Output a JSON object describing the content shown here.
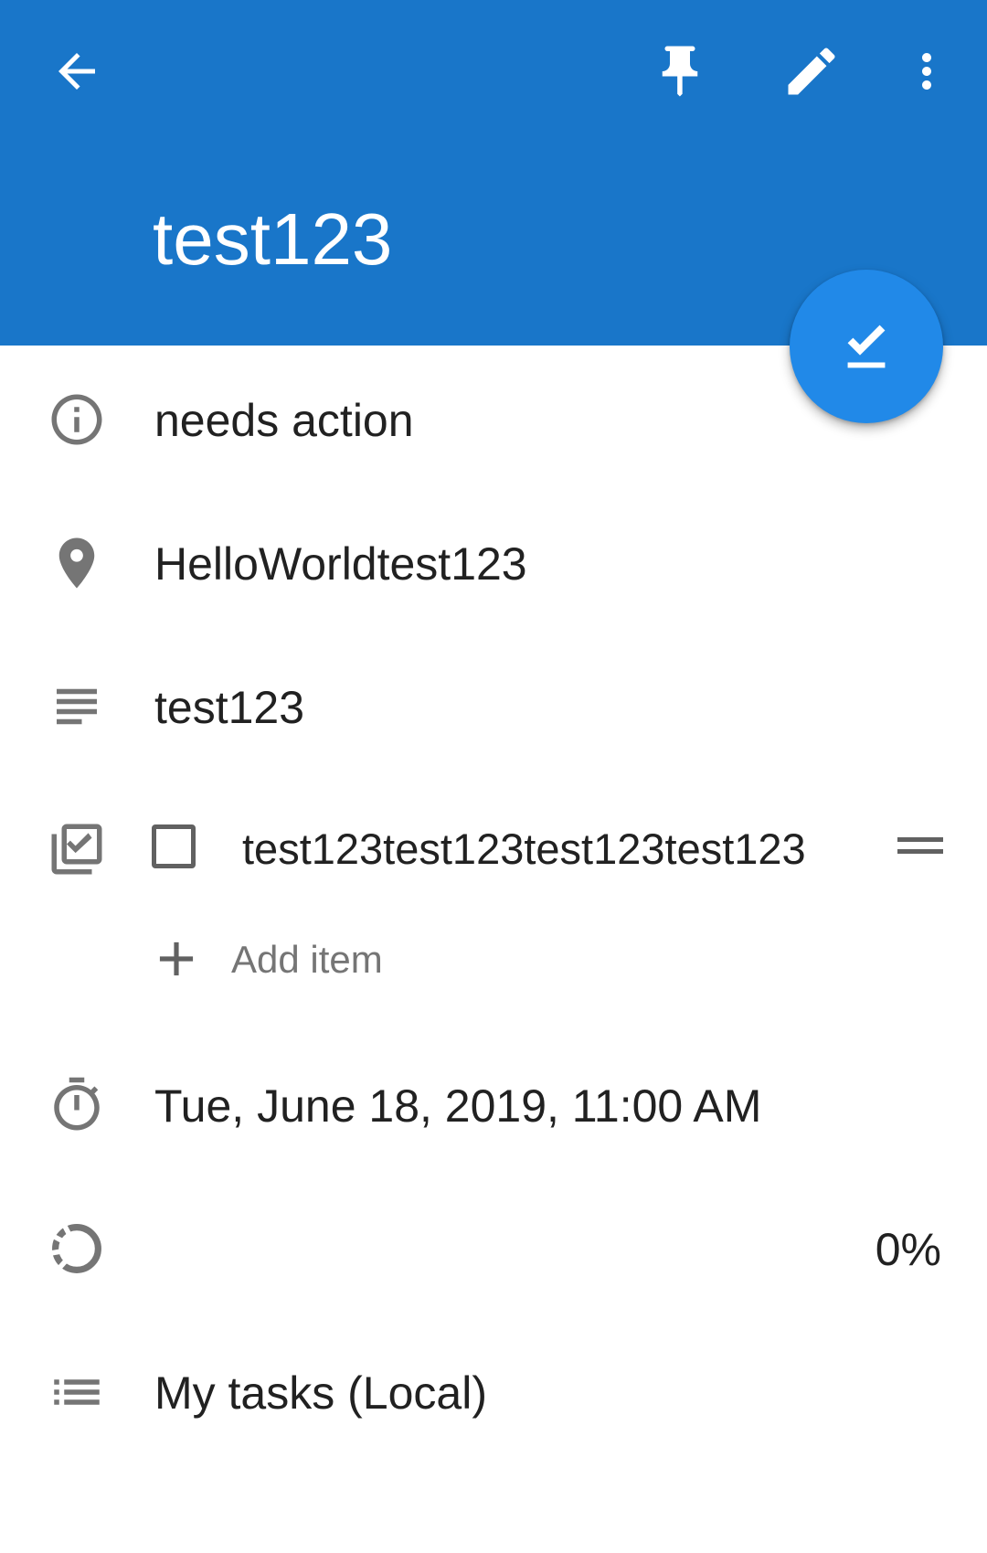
{
  "toolbar": {
    "back_icon": "arrow-back-icon",
    "pin_icon": "pin-icon",
    "edit_icon": "pencil-icon",
    "more_icon": "more-vert-icon"
  },
  "task": {
    "title": "test123"
  },
  "fab": {
    "icon": "check-icon"
  },
  "details": {
    "status": "needs action",
    "location": "HelloWorldtest123",
    "description": "test123",
    "checklist": {
      "items": [
        {
          "text": "test123test123test123test123",
          "checked": false
        }
      ],
      "add_item_label": "Add item"
    },
    "due": "Tue, June 18, 2019, 11:00 AM",
    "progress": "0%",
    "list": "My tasks (Local)"
  },
  "colors": {
    "app_bar": "#1976c9",
    "fab": "#2189e8",
    "icon_grey": "#757575"
  }
}
